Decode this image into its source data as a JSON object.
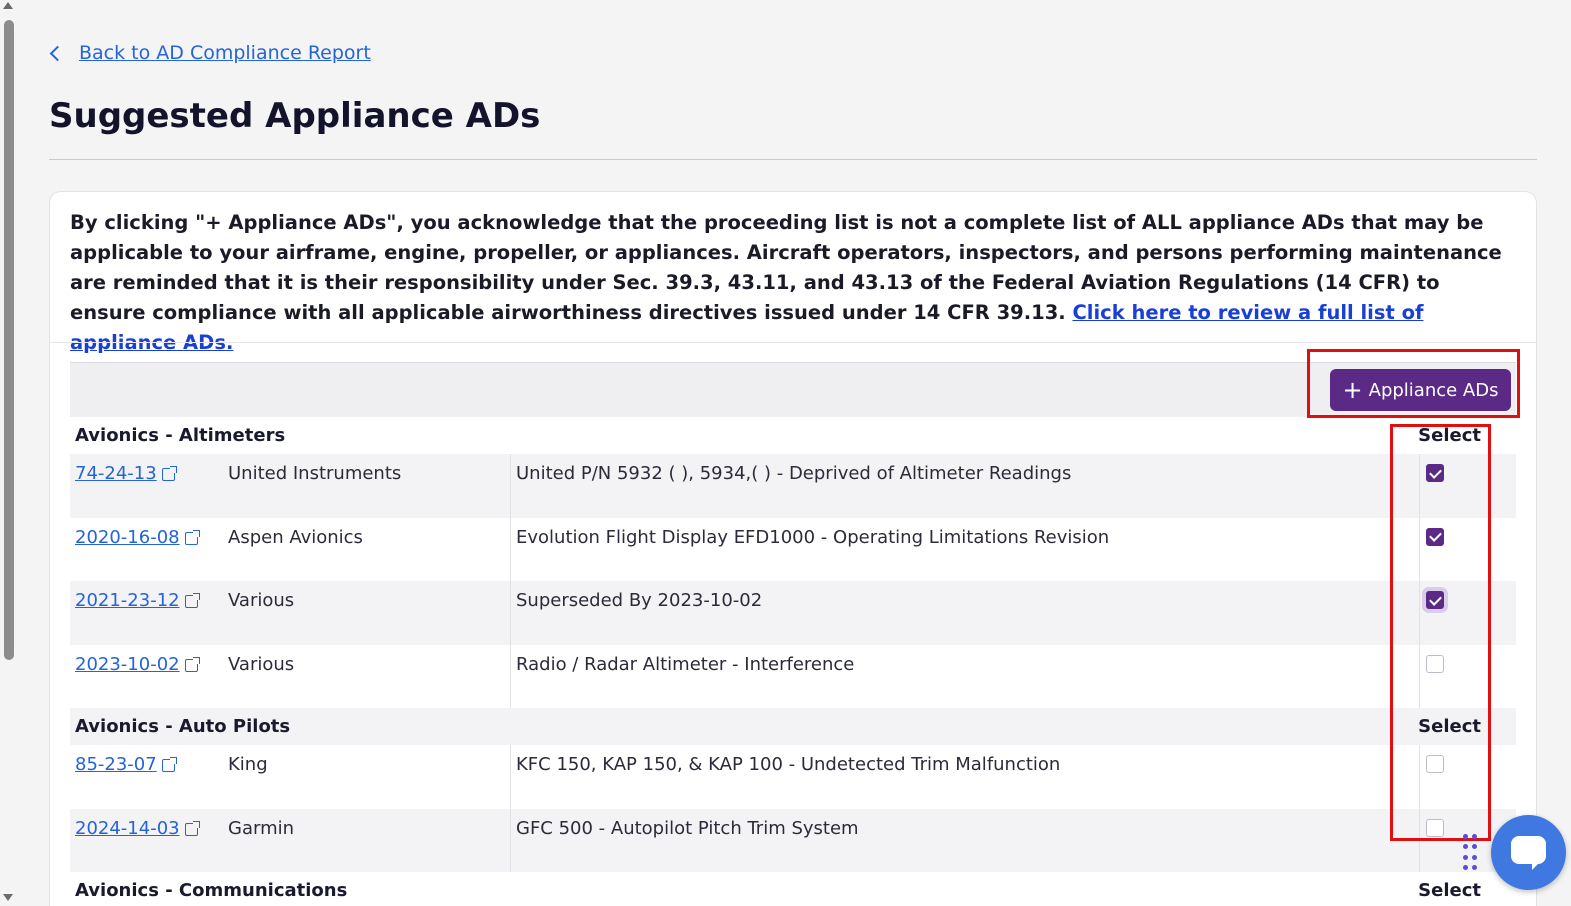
{
  "nav": {
    "back_label": "Back to AD Compliance Report"
  },
  "page": {
    "title": "Suggested Appliance ADs"
  },
  "disclaimer": {
    "text": "By clicking \"+ Appliance ADs\", you acknowledge that the proceeding list is not a complete list of ALL appliance ADs that may be applicable to your airframe, engine, propeller, or appliances. Aircraft operators, inspectors, and persons performing maintenance are reminded that it is their responsibility under Sec. 39.3, 43.11, and 43.13 of the Federal Aviation Regulations (14 CFR) to ensure compliance with all applicable airworthiness directives issued under 14 CFR 39.13.",
    "link_label": "Click here to review a full list of appliance ADs."
  },
  "toolbar": {
    "add_symbol": "+",
    "add_label": "Appliance ADs"
  },
  "select_label": "Select",
  "groups": [
    {
      "name": "Avionics - Altimeters",
      "rows": [
        {
          "ad": "74-24-13",
          "maker": "United Instruments",
          "desc": "United P/N 5932 ( ), 5934,( ) - Deprived of Altimeter Readings",
          "checked": true
        },
        {
          "ad": "2020-16-08",
          "maker": "Aspen Avionics",
          "desc": "Evolution Flight Display EFD1000 - Operating Limitations Revision",
          "checked": true
        },
        {
          "ad": "2021-23-12",
          "maker": "Various",
          "desc": "Superseded By 2023-10-02",
          "checked": true
        },
        {
          "ad": "2023-10-02",
          "maker": "Various",
          "desc": "Radio / Radar Altimeter - Interference",
          "checked": false
        }
      ]
    },
    {
      "name": "Avionics - Auto Pilots",
      "rows": [
        {
          "ad": "85-23-07",
          "maker": "King",
          "desc": "KFC 150, KAP 150, & KAP 100 - Undetected Trim Malfunction",
          "checked": false
        },
        {
          "ad": "2024-14-03",
          "maker": "Garmin",
          "desc": "GFC 500 - Autopilot Pitch Trim System",
          "checked": false
        }
      ]
    },
    {
      "name": "Avionics - Communications",
      "rows": []
    }
  ],
  "colors": {
    "accent": "#5b2a86",
    "link": "#2563d9",
    "highlight": "#e01010",
    "chat": "#3f78e0"
  },
  "icons": {
    "back": "chevron-left-icon",
    "external": "external-link-icon",
    "chat": "chat-icon",
    "drag": "drag-handle-icon"
  }
}
